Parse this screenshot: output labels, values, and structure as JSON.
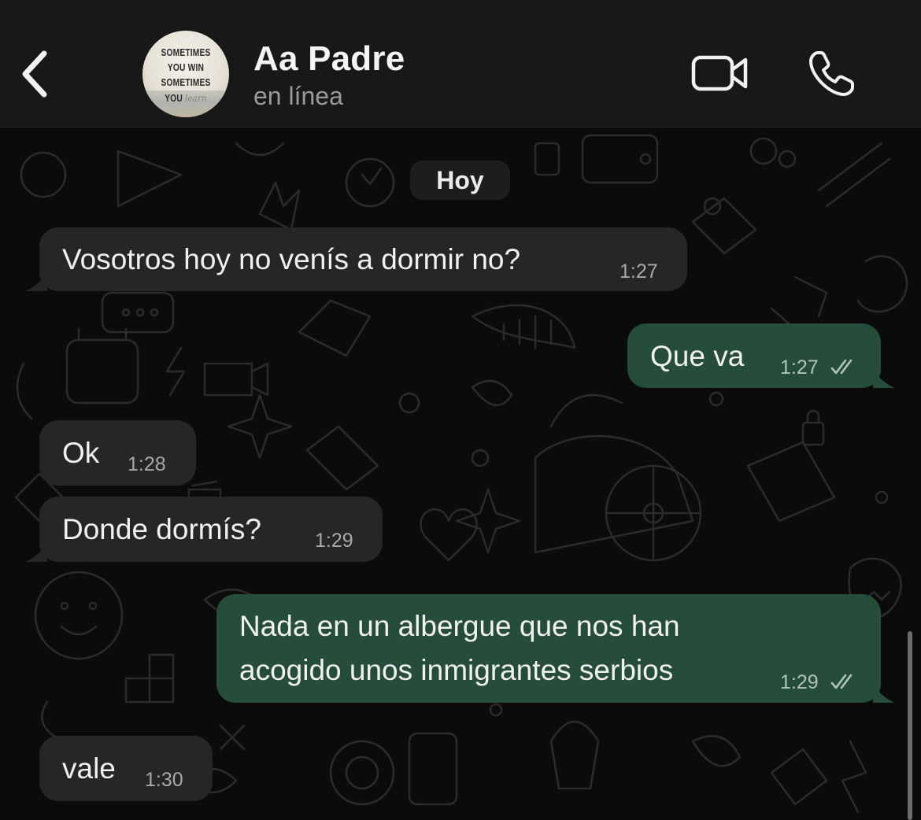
{
  "header": {
    "back_label": "Back",
    "contact_name": "Aa Padre",
    "status": "en línea",
    "avatar_quote": {
      "line1": "SOMETIMES",
      "line2": "YOU WIN",
      "line3": "SOMETIMES",
      "line4_prefix": "YOU",
      "line4_script": "learn"
    },
    "icons": {
      "back": "chevron-left-icon",
      "video": "video-camera-icon",
      "call": "phone-icon"
    }
  },
  "chat": {
    "day_separator": "Hoy",
    "messages": [
      {
        "direction": "incoming",
        "lines": [
          "Vosotros hoy no venís a dormir no?"
        ],
        "time": "1:27"
      },
      {
        "direction": "outgoing",
        "lines": [
          "Que va"
        ],
        "time": "1:27",
        "status": "read"
      },
      {
        "direction": "incoming",
        "lines": [
          "Ok"
        ],
        "time": "1:28"
      },
      {
        "direction": "incoming",
        "lines": [
          "Donde dormís?"
        ],
        "time": "1:29"
      },
      {
        "direction": "outgoing",
        "lines": [
          "Nada en un albergue que nos han",
          "acogido unos inmigrantes serbios"
        ],
        "time": "1:29",
        "status": "read"
      },
      {
        "direction": "incoming",
        "lines": [
          "vale"
        ],
        "time": "1:30"
      }
    ]
  },
  "colors": {
    "background": "#0b0b0b",
    "header_background": "#181818",
    "incoming_bubble": "#262626",
    "outgoing_bubble": "#254d3a",
    "text": "#f1f1f1",
    "secondary_text": "#9a9a9a"
  }
}
